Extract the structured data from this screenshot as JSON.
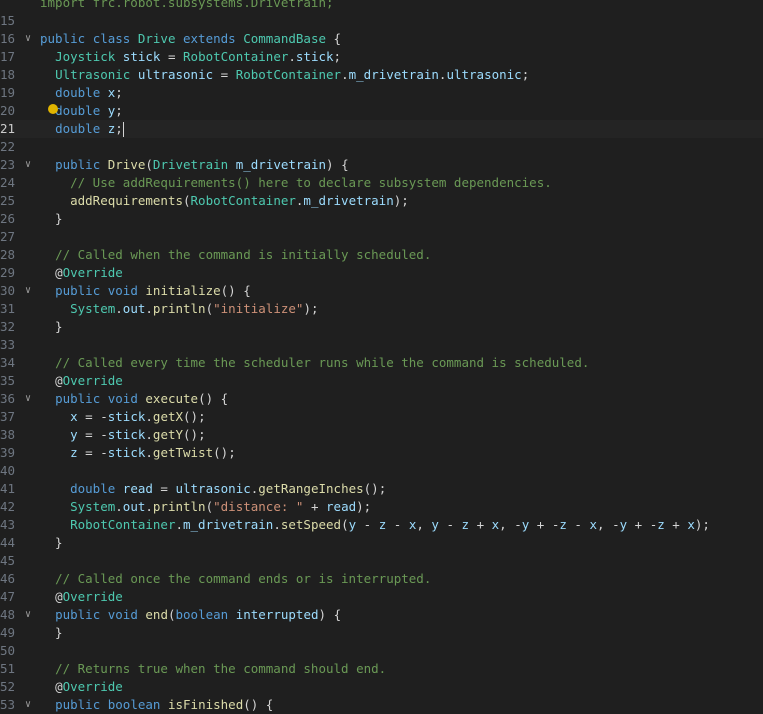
{
  "editor": {
    "current_line": 21,
    "lines": [
      {
        "n": "",
        "fold": "",
        "tokens": [
          [
            "cm",
            "import frc.robot.subsystems.Drivetrain;"
          ]
        ]
      },
      {
        "n": "15",
        "fold": "",
        "tokens": []
      },
      {
        "n": "16",
        "fold": "v",
        "tokens": [
          [
            "kw",
            "public "
          ],
          [
            "kw",
            "class "
          ],
          [
            "cls",
            "Drive "
          ],
          [
            "kw",
            "extends "
          ],
          [
            "cls",
            "CommandBase "
          ],
          [
            "pl",
            "{"
          ]
        ]
      },
      {
        "n": "17",
        "fold": "",
        "tokens": [
          [
            "pl",
            "  "
          ],
          [
            "cls",
            "Joystick "
          ],
          [
            "var",
            "stick"
          ],
          [
            "pl",
            " = "
          ],
          [
            "cls",
            "RobotContainer"
          ],
          [
            "pl",
            "."
          ],
          [
            "var",
            "stick"
          ],
          [
            "pl",
            ";"
          ]
        ]
      },
      {
        "n": "18",
        "fold": "",
        "tokens": [
          [
            "pl",
            "  "
          ],
          [
            "cls",
            "Ultrasonic "
          ],
          [
            "var",
            "ultrasonic"
          ],
          [
            "pl",
            " = "
          ],
          [
            "cls",
            "RobotContainer"
          ],
          [
            "pl",
            "."
          ],
          [
            "var",
            "m_drivetrain"
          ],
          [
            "pl",
            "."
          ],
          [
            "var",
            "ultrasonic"
          ],
          [
            "pl",
            ";"
          ]
        ]
      },
      {
        "n": "19",
        "fold": "",
        "tokens": [
          [
            "pl",
            "  "
          ],
          [
            "kw",
            "double "
          ],
          [
            "var",
            "x"
          ],
          [
            "pl",
            ";"
          ]
        ]
      },
      {
        "n": "20",
        "fold": "",
        "tokens": [
          [
            "pl",
            "  "
          ],
          [
            "kw",
            "double "
          ],
          [
            "var",
            "y"
          ],
          [
            "pl",
            ";"
          ]
        ]
      },
      {
        "n": "21",
        "fold": "",
        "tokens": [
          [
            "pl",
            "  "
          ],
          [
            "kw",
            "double "
          ],
          [
            "var",
            "z"
          ],
          [
            "pl",
            ";"
          ]
        ]
      },
      {
        "n": "22",
        "fold": "",
        "tokens": []
      },
      {
        "n": "23",
        "fold": "v",
        "tokens": [
          [
            "pl",
            "  "
          ],
          [
            "kw",
            "public "
          ],
          [
            "fn",
            "Drive"
          ],
          [
            "pl",
            "("
          ],
          [
            "cls",
            "Drivetrain "
          ],
          [
            "var",
            "m_drivetrain"
          ],
          [
            "pl",
            ") {"
          ]
        ]
      },
      {
        "n": "24",
        "fold": "",
        "tokens": [
          [
            "pl",
            "    "
          ],
          [
            "cm",
            "// Use addRequirements() here to declare subsystem dependencies."
          ]
        ]
      },
      {
        "n": "25",
        "fold": "",
        "tokens": [
          [
            "pl",
            "    "
          ],
          [
            "fn",
            "addRequirements"
          ],
          [
            "pl",
            "("
          ],
          [
            "cls",
            "RobotContainer"
          ],
          [
            "pl",
            "."
          ],
          [
            "var",
            "m_drivetrain"
          ],
          [
            "pl",
            ");"
          ]
        ]
      },
      {
        "n": "26",
        "fold": "",
        "tokens": [
          [
            "pl",
            "  }"
          ]
        ]
      },
      {
        "n": "27",
        "fold": "",
        "tokens": []
      },
      {
        "n": "28",
        "fold": "",
        "tokens": [
          [
            "pl",
            "  "
          ],
          [
            "cm",
            "// Called when the command is initially scheduled."
          ]
        ]
      },
      {
        "n": "29",
        "fold": "",
        "tokens": [
          [
            "pl",
            "  "
          ],
          [
            "at",
            "@"
          ],
          [
            "ann",
            "Override"
          ]
        ]
      },
      {
        "n": "30",
        "fold": "v",
        "tokens": [
          [
            "pl",
            "  "
          ],
          [
            "kw",
            "public "
          ],
          [
            "kw",
            "void "
          ],
          [
            "fn",
            "initialize"
          ],
          [
            "pl",
            "() {"
          ]
        ]
      },
      {
        "n": "31",
        "fold": "",
        "tokens": [
          [
            "pl",
            "    "
          ],
          [
            "cls",
            "System"
          ],
          [
            "pl",
            "."
          ],
          [
            "var",
            "out"
          ],
          [
            "pl",
            "."
          ],
          [
            "fn",
            "println"
          ],
          [
            "pl",
            "("
          ],
          [
            "str",
            "\"initialize\""
          ],
          [
            "pl",
            ");"
          ]
        ]
      },
      {
        "n": "32",
        "fold": "",
        "tokens": [
          [
            "pl",
            "  }"
          ]
        ]
      },
      {
        "n": "33",
        "fold": "",
        "tokens": []
      },
      {
        "n": "34",
        "fold": "",
        "tokens": [
          [
            "pl",
            "  "
          ],
          [
            "cm",
            "// Called every time the scheduler runs while the command is scheduled."
          ]
        ]
      },
      {
        "n": "35",
        "fold": "",
        "tokens": [
          [
            "pl",
            "  "
          ],
          [
            "at",
            "@"
          ],
          [
            "ann",
            "Override"
          ]
        ]
      },
      {
        "n": "36",
        "fold": "v",
        "tokens": [
          [
            "pl",
            "  "
          ],
          [
            "kw",
            "public "
          ],
          [
            "kw",
            "void "
          ],
          [
            "fn",
            "execute"
          ],
          [
            "pl",
            "() {"
          ]
        ]
      },
      {
        "n": "37",
        "fold": "",
        "tokens": [
          [
            "pl",
            "    "
          ],
          [
            "var",
            "x"
          ],
          [
            "pl",
            " = -"
          ],
          [
            "var",
            "stick"
          ],
          [
            "pl",
            "."
          ],
          [
            "fn",
            "getX"
          ],
          [
            "pl",
            "();"
          ]
        ]
      },
      {
        "n": "38",
        "fold": "",
        "tokens": [
          [
            "pl",
            "    "
          ],
          [
            "var",
            "y"
          ],
          [
            "pl",
            " = -"
          ],
          [
            "var",
            "stick"
          ],
          [
            "pl",
            "."
          ],
          [
            "fn",
            "getY"
          ],
          [
            "pl",
            "();"
          ]
        ]
      },
      {
        "n": "39",
        "fold": "",
        "tokens": [
          [
            "pl",
            "    "
          ],
          [
            "var",
            "z"
          ],
          [
            "pl",
            " = -"
          ],
          [
            "var",
            "stick"
          ],
          [
            "pl",
            "."
          ],
          [
            "fn",
            "getTwist"
          ],
          [
            "pl",
            "();"
          ]
        ]
      },
      {
        "n": "40",
        "fold": "",
        "tokens": []
      },
      {
        "n": "41",
        "fold": "",
        "tokens": [
          [
            "pl",
            "    "
          ],
          [
            "kw",
            "double "
          ],
          [
            "var",
            "read"
          ],
          [
            "pl",
            " = "
          ],
          [
            "var",
            "ultrasonic"
          ],
          [
            "pl",
            "."
          ],
          [
            "fn",
            "getRangeInches"
          ],
          [
            "pl",
            "();"
          ]
        ]
      },
      {
        "n": "42",
        "fold": "",
        "tokens": [
          [
            "pl",
            "    "
          ],
          [
            "cls",
            "System"
          ],
          [
            "pl",
            "."
          ],
          [
            "var",
            "out"
          ],
          [
            "pl",
            "."
          ],
          [
            "fn",
            "println"
          ],
          [
            "pl",
            "("
          ],
          [
            "str",
            "\"distance: \""
          ],
          [
            "pl",
            " + "
          ],
          [
            "var",
            "read"
          ],
          [
            "pl",
            ");"
          ]
        ]
      },
      {
        "n": "43",
        "fold": "",
        "tokens": [
          [
            "pl",
            "    "
          ],
          [
            "cls",
            "RobotContainer"
          ],
          [
            "pl",
            "."
          ],
          [
            "var",
            "m_drivetrain"
          ],
          [
            "pl",
            "."
          ],
          [
            "fn",
            "setSpeed"
          ],
          [
            "pl",
            "("
          ],
          [
            "var",
            "y"
          ],
          [
            "pl",
            " - "
          ],
          [
            "var",
            "z"
          ],
          [
            "pl",
            " - "
          ],
          [
            "var",
            "x"
          ],
          [
            "pl",
            ", "
          ],
          [
            "var",
            "y"
          ],
          [
            "pl",
            " - "
          ],
          [
            "var",
            "z"
          ],
          [
            "pl",
            " + "
          ],
          [
            "var",
            "x"
          ],
          [
            "pl",
            ", -"
          ],
          [
            "var",
            "y"
          ],
          [
            "pl",
            " + -"
          ],
          [
            "var",
            "z"
          ],
          [
            "pl",
            " - "
          ],
          [
            "var",
            "x"
          ],
          [
            "pl",
            ", -"
          ],
          [
            "var",
            "y"
          ],
          [
            "pl",
            " + -"
          ],
          [
            "var",
            "z"
          ],
          [
            "pl",
            " + "
          ],
          [
            "var",
            "x"
          ],
          [
            "pl",
            ");"
          ]
        ]
      },
      {
        "n": "44",
        "fold": "",
        "tokens": [
          [
            "pl",
            "  }"
          ]
        ]
      },
      {
        "n": "45",
        "fold": "",
        "tokens": []
      },
      {
        "n": "46",
        "fold": "",
        "tokens": [
          [
            "pl",
            "  "
          ],
          [
            "cm",
            "// Called once the command ends or is interrupted."
          ]
        ]
      },
      {
        "n": "47",
        "fold": "",
        "tokens": [
          [
            "pl",
            "  "
          ],
          [
            "at",
            "@"
          ],
          [
            "ann",
            "Override"
          ]
        ]
      },
      {
        "n": "48",
        "fold": "v",
        "tokens": [
          [
            "pl",
            "  "
          ],
          [
            "kw",
            "public "
          ],
          [
            "kw",
            "void "
          ],
          [
            "fn",
            "end"
          ],
          [
            "pl",
            "("
          ],
          [
            "kw",
            "boolean "
          ],
          [
            "var",
            "interrupted"
          ],
          [
            "pl",
            ") {"
          ]
        ]
      },
      {
        "n": "49",
        "fold": "",
        "tokens": [
          [
            "pl",
            "  }"
          ]
        ]
      },
      {
        "n": "50",
        "fold": "",
        "tokens": []
      },
      {
        "n": "51",
        "fold": "",
        "tokens": [
          [
            "pl",
            "  "
          ],
          [
            "cm",
            "// Returns true when the command should end."
          ]
        ]
      },
      {
        "n": "52",
        "fold": "",
        "tokens": [
          [
            "pl",
            "  "
          ],
          [
            "at",
            "@"
          ],
          [
            "ann",
            "Override"
          ]
        ]
      },
      {
        "n": "53",
        "fold": "v",
        "tokens": [
          [
            "pl",
            "  "
          ],
          [
            "kw",
            "public "
          ],
          [
            "kw",
            "boolean "
          ],
          [
            "fn",
            "isFinished"
          ],
          [
            "pl",
            "() {"
          ]
        ]
      }
    ],
    "lightbulb_line": 20,
    "colors": {
      "background": "#1f1f1f",
      "keyword": "#569cd6",
      "type": "#4ec9b0",
      "function": "#dcdcaa",
      "variable": "#9cdcfe",
      "string": "#ce9178",
      "comment": "#6a9955"
    }
  }
}
